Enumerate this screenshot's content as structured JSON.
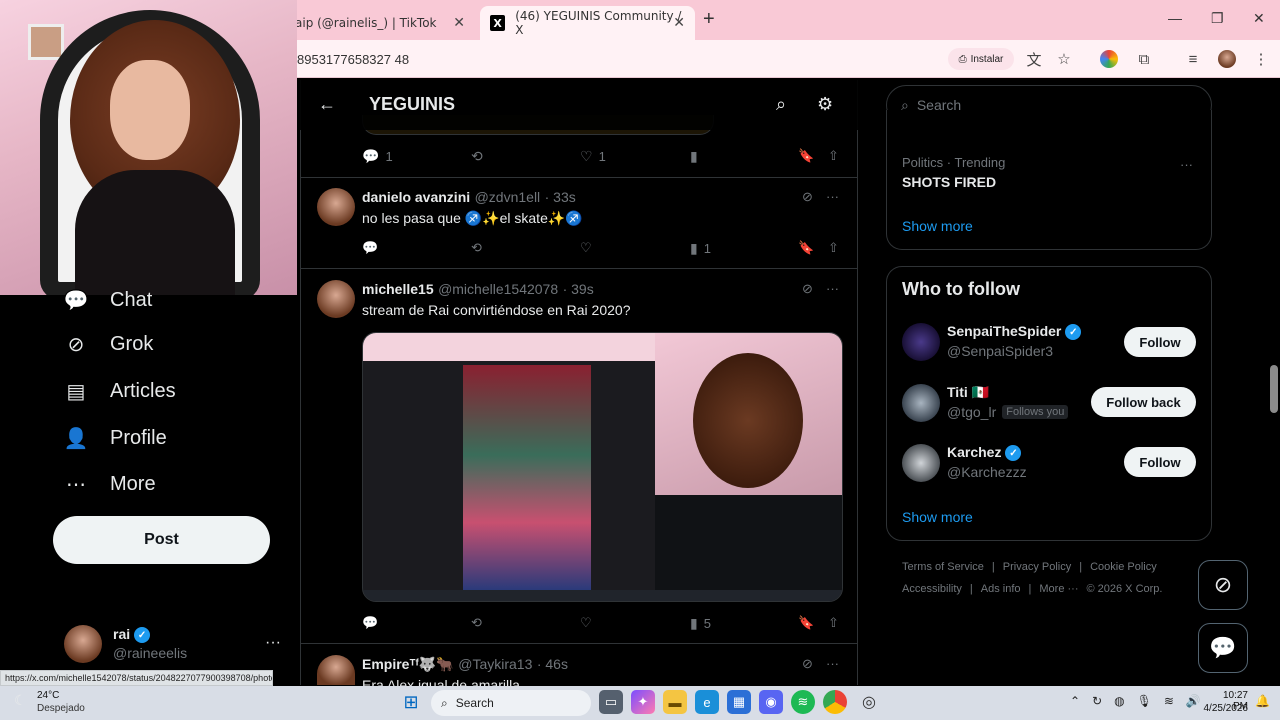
{
  "browser": {
    "tabs": [
      {
        "title": "aip (@rainelis_) | TikTok"
      },
      {
        "title": "(46) YEGUINIS Community / X"
      }
    ],
    "url": "8953177658327 48",
    "install_label": "Instalar"
  },
  "nav": {
    "items": [
      {
        "label": "Chat",
        "icon": "chat-icon"
      },
      {
        "label": "Grok",
        "icon": "grok-icon"
      },
      {
        "label": "Articles",
        "icon": "articles-icon"
      },
      {
        "label": "Profile",
        "icon": "profile-icon"
      },
      {
        "label": "More",
        "icon": "more-icon"
      }
    ],
    "post_label": "Post",
    "account": {
      "name": "rai",
      "handle": "@raineeelis"
    }
  },
  "status_url": "https://x.com/michelle1542078/status/2048227077900398708/photo/1",
  "header": {
    "title": "YEGUINIS"
  },
  "top_tweet_actions": {
    "replies": "1",
    "likes": "1"
  },
  "tweets": [
    {
      "name": "danielo avanzini",
      "handle": "@zdvn1ell",
      "time": "· 33s",
      "text": "no les pasa que ♐✨el skate✨♐",
      "views": "1"
    },
    {
      "name": "michelle15",
      "handle": "@michelle1542078",
      "time": "· 39s",
      "text": "stream de Rai convirtiéndose en Rai 2020?",
      "views": "5"
    },
    {
      "name": "Empireᵀᶠ🐺🐂",
      "handle": "@Taykira13",
      "time": "· 46s",
      "text": "Era Alex igual de amarilla"
    }
  ],
  "search": {
    "placeholder": "Search"
  },
  "trending": {
    "category": "Politics · Trending",
    "title": "SHOTS FIRED",
    "show_more": "Show more"
  },
  "who_to_follow": {
    "title": "Who to follow",
    "users": [
      {
        "name": "SenpaiTheSpider",
        "handle": "@SenpaiSpider3",
        "button": "Follow",
        "verified": true
      },
      {
        "name": "Titi",
        "handle": "@tgo_lr",
        "badge": "Follows you",
        "button": "Follow back",
        "verified": false
      },
      {
        "name": "Karchez",
        "handle": "@Karchezzz",
        "button": "Follow",
        "verified": true
      }
    ],
    "show_more": "Show more"
  },
  "footer_links": [
    "Terms of Service",
    "Privacy Policy",
    "Cookie Policy",
    "Accessibility",
    "Ads info",
    "More ···",
    "© 2026 X Corp."
  ],
  "taskbar": {
    "weather_temp": "24°C",
    "weather_desc": "Despejado",
    "search_label": "Search",
    "time": "10:27 PM",
    "date": "4/25/2026"
  },
  "colors": {
    "accent": "#1d9bf0",
    "background": "#000000",
    "chrome": "#f9c9d6"
  }
}
